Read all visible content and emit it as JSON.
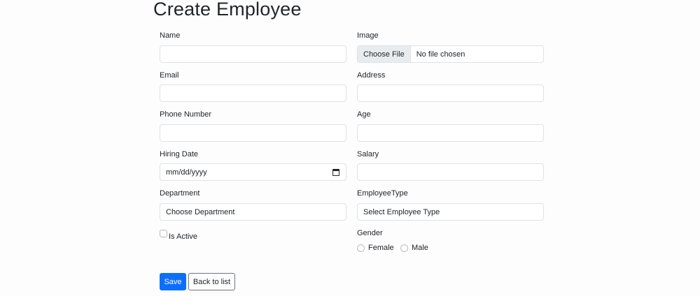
{
  "title": "Create Employee",
  "fields": {
    "name": {
      "label": "Name",
      "value": ""
    },
    "image": {
      "label": "Image",
      "button": "Choose File",
      "status": "No file chosen"
    },
    "email": {
      "label": "Email",
      "value": ""
    },
    "address": {
      "label": "Address",
      "value": ""
    },
    "phone": {
      "label": "Phone Number",
      "value": ""
    },
    "age": {
      "label": "Age",
      "value": ""
    },
    "hiring_date": {
      "label": "Hiring Date",
      "placeholder": "mm/dd/yyyy"
    },
    "salary": {
      "label": "Salary",
      "value": ""
    },
    "department": {
      "label": "Department",
      "selected": "Choose Department"
    },
    "employee_type": {
      "label": "EmployeeType",
      "selected": "Select Employee Type"
    },
    "is_active": {
      "label": "Is Active",
      "checked": false
    },
    "gender": {
      "label": "Gender",
      "options": [
        "Female",
        "Male"
      ]
    }
  },
  "buttons": {
    "save": "Save",
    "back": "Back to list"
  }
}
